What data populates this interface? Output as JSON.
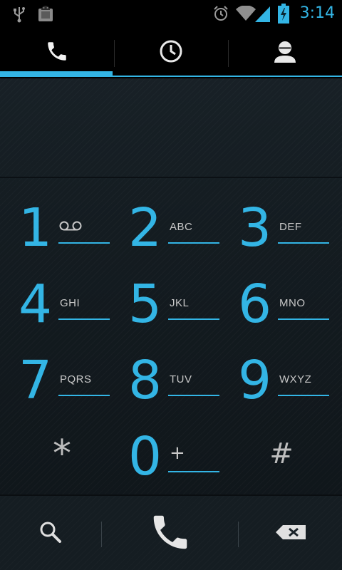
{
  "status_bar": {
    "icons": [
      "usb-icon",
      "android-debug-icon",
      "alarm-icon",
      "wifi-icon",
      "signal-icon",
      "battery-charging-icon"
    ],
    "time": "3:14",
    "accent_color": "#33b5e5"
  },
  "tabs": [
    {
      "icon": "phone-icon",
      "selected": true
    },
    {
      "icon": "call-log-clock-icon",
      "selected": false
    },
    {
      "icon": "contacts-person-icon",
      "selected": false
    }
  ],
  "digits": {
    "value": ""
  },
  "keypad": {
    "keys": [
      {
        "digit": "1",
        "letters": "",
        "extra_icon": "voicemail-icon"
      },
      {
        "digit": "2",
        "letters": "ABC"
      },
      {
        "digit": "3",
        "letters": "DEF"
      },
      {
        "digit": "4",
        "letters": "GHI"
      },
      {
        "digit": "5",
        "letters": "JKL"
      },
      {
        "digit": "6",
        "letters": "MNO"
      },
      {
        "digit": "7",
        "letters": "PQRS"
      },
      {
        "digit": "8",
        "letters": "TUV"
      },
      {
        "digit": "9",
        "letters": "WXYZ"
      },
      {
        "digit": "*",
        "letters": ""
      },
      {
        "digit": "0",
        "letters": "+"
      },
      {
        "digit": "#",
        "letters": ""
      }
    ]
  },
  "actions": {
    "search_icon": "search-icon",
    "call_icon": "call-icon",
    "delete_icon": "backspace-icon"
  }
}
